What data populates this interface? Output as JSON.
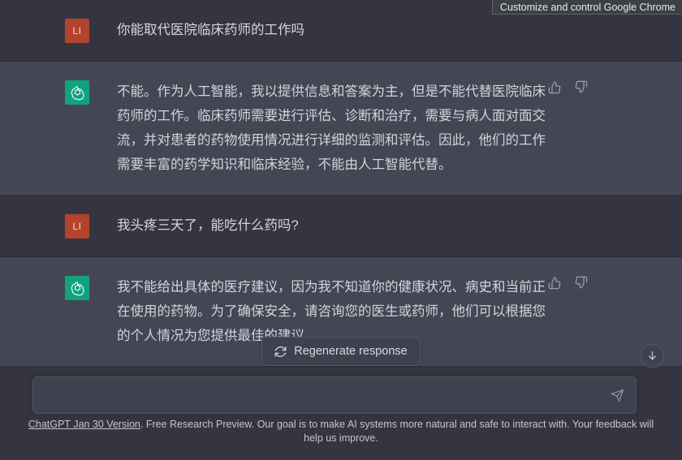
{
  "browser": {
    "tooltip": "Customize and control Google Chrome"
  },
  "colors": {
    "user_row_bg": "#343541",
    "assistant_row_bg": "#444654",
    "user_avatar_bg": "#b4432d",
    "assistant_avatar_bg": "#10a37f",
    "composer_bg": "#40414f",
    "text": "#d1d5db"
  },
  "conversation": {
    "messages": [
      {
        "role": "user",
        "avatar_initials": "LI",
        "text": "你能取代医院临床药师的工作吗"
      },
      {
        "role": "assistant",
        "avatar_icon": "openai-logo-icon",
        "text": "不能。作为人工智能，我以提供信息和答案为主，但是不能代替医院临床药师的工作。临床药师需要进行评估、诊断和治疗，需要与病人面对面交流，并对患者的药物使用情况进行详细的监测和评估。因此，他们的工作需要丰富的药学知识和临床经验，不能由人工智能代替。",
        "feedback": {
          "thumbs_up": "thumbs-up-icon",
          "thumbs_down": "thumbs-down-icon"
        }
      },
      {
        "role": "user",
        "avatar_initials": "LI",
        "text": "我头疼三天了，能吃什么药吗?"
      },
      {
        "role": "assistant",
        "avatar_icon": "openai-logo-icon",
        "text": "我不能给出具体的医疗建议，因为我不知道你的健康状况、病史和当前正在使用的药物。为了确保安全，请咨询您的医生或药师，他们可以根据您的个人情况为您提供最佳的建议。",
        "feedback": {
          "thumbs_up": "thumbs-up-icon",
          "thumbs_down": "thumbs-down-icon"
        }
      }
    ]
  },
  "composer": {
    "regenerate_label": "Regenerate response",
    "regenerate_icon": "refresh-icon",
    "scroll_bottom_icon": "arrow-down-icon",
    "input_value": "",
    "input_placeholder": "",
    "send_icon": "send-paper-plane-icon"
  },
  "footer": {
    "version_link": "ChatGPT Jan 30 Version",
    "disclaimer": ". Free Research Preview. Our goal is to make AI systems more natural and safe to interact with. Your feedback will help us improve."
  }
}
